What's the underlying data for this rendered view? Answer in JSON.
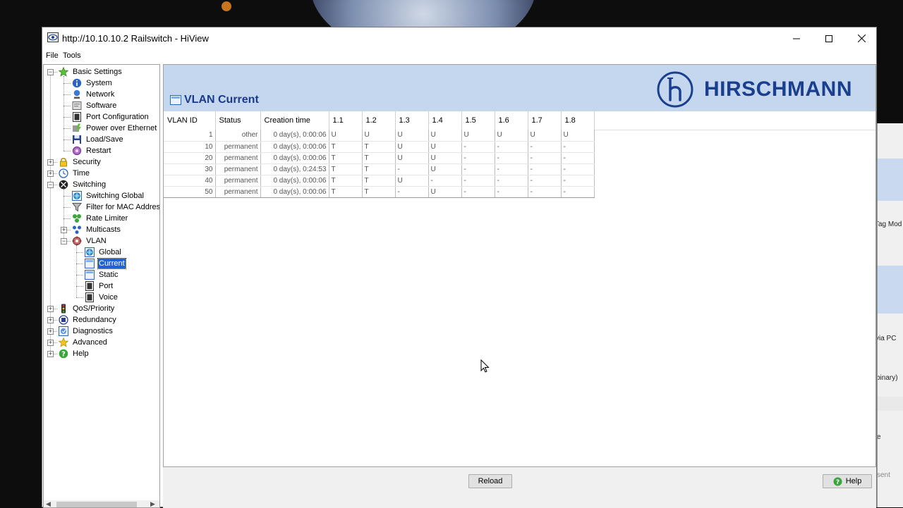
{
  "window": {
    "title": "http://10.10.10.2 Railswitch - HiView",
    "minimize_icon": "minimize-icon",
    "maximize_icon": "maximize-icon",
    "close_icon": "close-icon"
  },
  "menu": [
    "File",
    "Tools"
  ],
  "tree": {
    "items": [
      {
        "label": "Basic Settings",
        "icon": "star-icon",
        "level": 0,
        "expander": "-"
      },
      {
        "label": "System",
        "icon": "info-icon",
        "level": 1
      },
      {
        "label": "Network",
        "icon": "network-icon",
        "level": 1
      },
      {
        "label": "Software",
        "icon": "software-icon",
        "level": 1
      },
      {
        "label": "Port Configuration",
        "icon": "port-icon",
        "level": 1
      },
      {
        "label": "Power over Ethernet",
        "icon": "poe-icon",
        "level": 1
      },
      {
        "label": "Load/Save",
        "icon": "floppy-icon",
        "level": 1
      },
      {
        "label": "Restart",
        "icon": "restart-icon",
        "level": 1
      },
      {
        "label": "Security",
        "icon": "lock-icon",
        "level": 0,
        "expander": "+"
      },
      {
        "label": "Time",
        "icon": "clock-icon",
        "level": 0,
        "expander": "+"
      },
      {
        "label": "Switching",
        "icon": "switching-icon",
        "level": 0,
        "expander": "-"
      },
      {
        "label": "Switching Global",
        "icon": "globe-icon",
        "level": 1
      },
      {
        "label": "Filter for MAC Addresses",
        "icon": "filter-icon",
        "level": 1
      },
      {
        "label": "Rate Limiter",
        "icon": "rate-limiter-icon",
        "level": 1
      },
      {
        "label": "Multicasts",
        "icon": "multicast-icon",
        "level": 1,
        "expander": "+"
      },
      {
        "label": "VLAN",
        "icon": "vlan-icon",
        "level": 1,
        "expander": "-"
      },
      {
        "label": "Global",
        "icon": "globe-icon",
        "level": 2
      },
      {
        "label": "Current",
        "icon": "table-icon",
        "level": 2,
        "selected": true
      },
      {
        "label": "Static",
        "icon": "table-icon",
        "level": 2
      },
      {
        "label": "Port",
        "icon": "port-icon",
        "level": 2
      },
      {
        "label": "Voice",
        "icon": "voice-icon",
        "level": 2
      },
      {
        "label": "QoS/Priority",
        "icon": "traffic-light-icon",
        "level": 0,
        "expander": "+"
      },
      {
        "label": "Redundancy",
        "icon": "redundancy-icon",
        "level": 0,
        "expander": "+"
      },
      {
        "label": "Diagnostics",
        "icon": "diagnostics-icon",
        "level": 0,
        "expander": "+"
      },
      {
        "label": "Advanced",
        "icon": "advanced-star-icon",
        "level": 0,
        "expander": "+"
      },
      {
        "label": "Help",
        "icon": "help-icon",
        "level": 0,
        "expander": "+"
      }
    ]
  },
  "content": {
    "page_title": "VLAN Current",
    "brand": "HIRSCHMANN",
    "table": {
      "columns": [
        "VLAN ID",
        "Status",
        "Creation time",
        "1.1",
        "1.2",
        "1.3",
        "1.4",
        "1.5",
        "1.6",
        "1.7",
        "1.8"
      ],
      "rows": [
        [
          "1",
          "other",
          "0 day(s), 0:00:06",
          "U",
          "U",
          "U",
          "U",
          "U",
          "U",
          "U",
          "U"
        ],
        [
          "10",
          "permanent",
          "0 day(s), 0:00:06",
          "T",
          "T",
          "U",
          "U",
          "-",
          "-",
          "-",
          "-"
        ],
        [
          "20",
          "permanent",
          "0 day(s), 0:00:06",
          "T",
          "T",
          "U",
          "U",
          "-",
          "-",
          "-",
          "-"
        ],
        [
          "30",
          "permanent",
          "0 day(s), 0:24:53",
          "T",
          "T",
          "-",
          "U",
          "-",
          "-",
          "-",
          "-"
        ],
        [
          "40",
          "permanent",
          "0 day(s), 0:00:06",
          "T",
          "T",
          "U",
          "-",
          "-",
          "-",
          "-",
          "-"
        ],
        [
          "50",
          "permanent",
          "0 day(s), 0:00:06",
          "T",
          "T",
          "-",
          "U",
          "-",
          "-",
          "-",
          "-"
        ]
      ]
    }
  },
  "buttons": {
    "reload": "Reload",
    "help": "Help"
  },
  "background_window": {
    "texts": [
      "Tag Mod",
      "via PC",
      "binary)",
      "e",
      "sent"
    ]
  },
  "colors": {
    "header_band": "#c5d7ef",
    "brand_blue": "#1b3f8f",
    "selection": "#1e63d6"
  }
}
